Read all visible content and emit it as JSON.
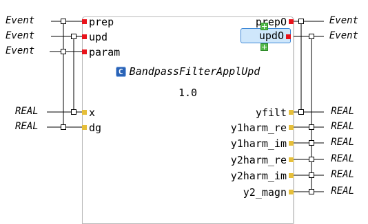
{
  "block": {
    "type_name": "BandpassFilterApplUpd",
    "version": "1.0",
    "type_icon": "C",
    "inputs": [
      {
        "name": "prep",
        "kind": "event"
      },
      {
        "name": "upd",
        "kind": "event"
      },
      {
        "name": "param",
        "kind": "event"
      },
      {
        "name": "x",
        "kind": "data"
      },
      {
        "name": "dg",
        "kind": "data"
      }
    ],
    "outputs": [
      {
        "name": "prepO",
        "kind": "event"
      },
      {
        "name": "updO",
        "kind": "event"
      },
      {
        "name": "yfilt",
        "kind": "data"
      },
      {
        "name": "y1harm_re",
        "kind": "data"
      },
      {
        "name": "y1harm_im",
        "kind": "data"
      },
      {
        "name": "y2harm_re",
        "kind": "data"
      },
      {
        "name": "y2harm_im",
        "kind": "data"
      },
      {
        "name": "y2_magn",
        "kind": "data"
      }
    ]
  },
  "external_inputs": [
    "Event",
    "Event",
    "Event",
    "REAL",
    "REAL"
  ],
  "external_outputs": [
    "Event",
    "Event",
    "REAL",
    "REAL",
    "REAL",
    "REAL",
    "REAL",
    "REAL"
  ],
  "colors": {
    "event_pin": "#e8131b",
    "data_pin": "#e6bf3a",
    "selection": "#cfe7fb",
    "selection_border": "#3b86d6"
  }
}
